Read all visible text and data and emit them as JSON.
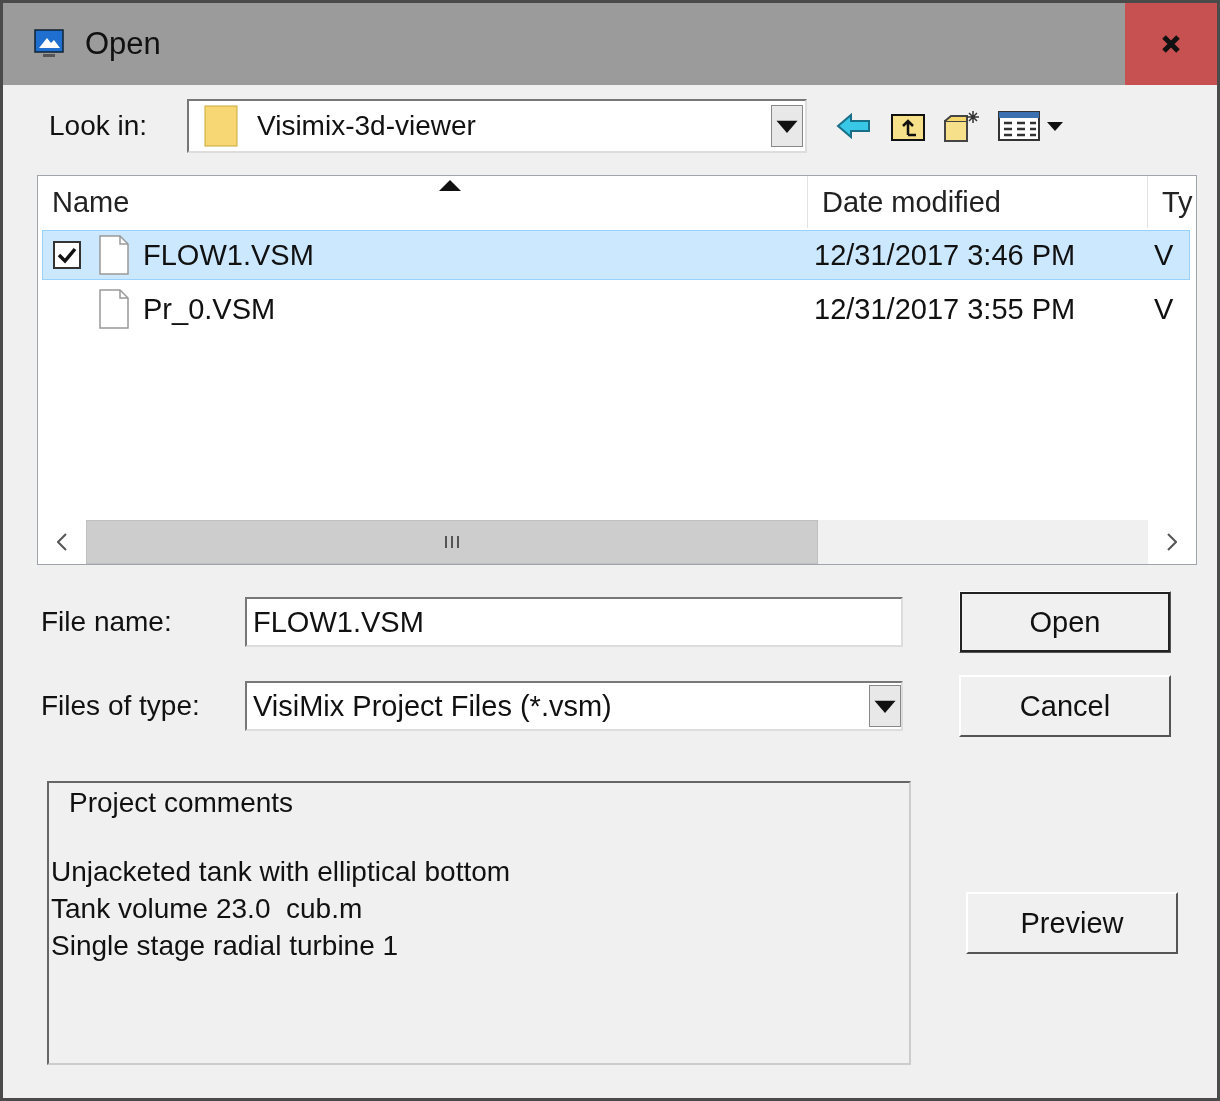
{
  "window": {
    "title": "Open"
  },
  "look_in": {
    "label": "Look in:",
    "value": "Visimix-3d-viewer"
  },
  "file_list": {
    "columns": [
      {
        "label": "Name",
        "sorted": true
      },
      {
        "label": "Date modified",
        "sorted": false
      },
      {
        "label": "Ty",
        "sorted": false
      }
    ],
    "rows": [
      {
        "name": "FLOW1.VSM",
        "date": "12/31/2017 3:46 PM",
        "type": "V",
        "selected": true,
        "checked": true
      },
      {
        "name": "Pr_0.VSM",
        "date": "12/31/2017 3:55 PM",
        "type": "V",
        "selected": false,
        "checked": false
      }
    ]
  },
  "file_name": {
    "label": "File name:",
    "value": "FLOW1.VSM"
  },
  "file_type": {
    "label": "Files of type:",
    "value": "VisiMix Project Files (*.vsm)"
  },
  "buttons": [
    {
      "label": "Open",
      "default": true
    },
    {
      "label": "Cancel",
      "default": false
    }
  ],
  "comments": {
    "title": "Project comments",
    "lines": [
      "Unjacketed tank with elliptical bottom",
      "Tank volume 23.0  cub.m",
      "Single stage radial turbine 1"
    ]
  },
  "preview_button": {
    "label": "Preview"
  }
}
